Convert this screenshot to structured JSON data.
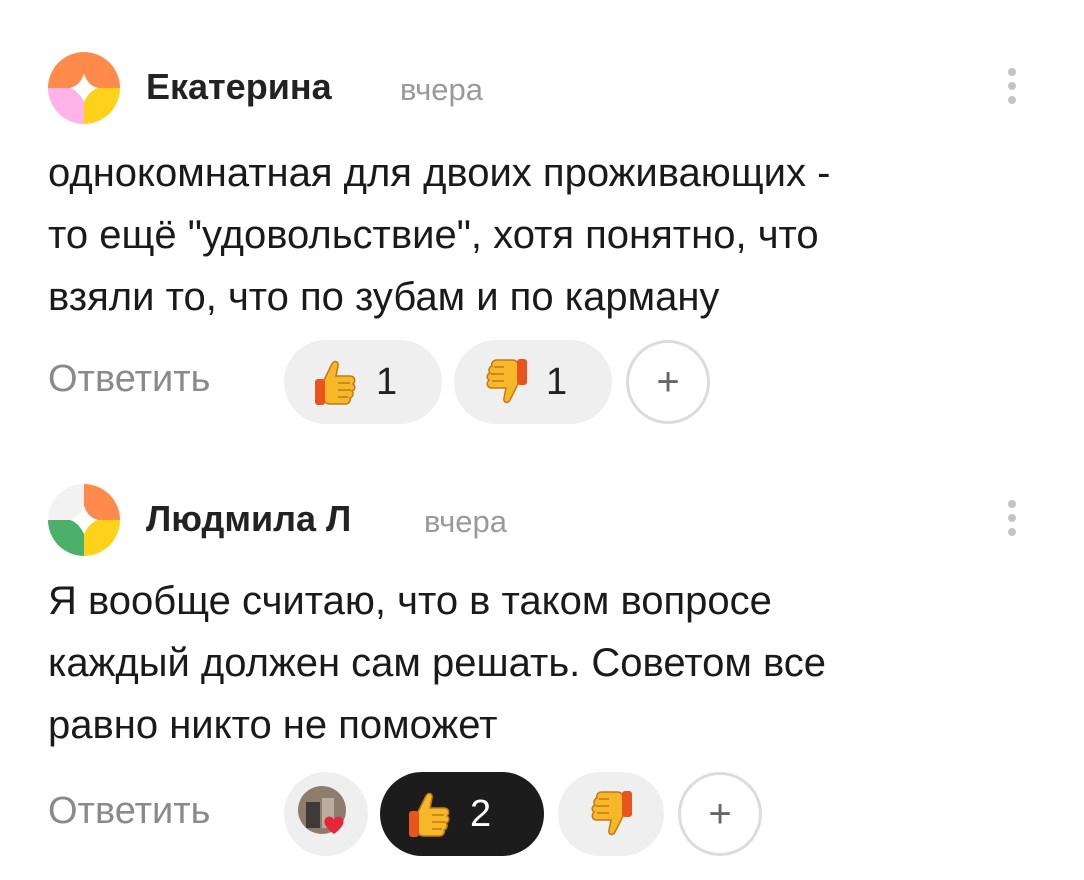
{
  "comments": [
    {
      "author": "Екатерина",
      "time": "вчера",
      "lines": [
        "однокомнатная для двоих проживающих -",
        "то ещё \"удовольствие\", хотя понятно, что",
        "взяли то, что по зубам и по карману"
      ],
      "reply_label": "Ответить",
      "likes": "1",
      "dislikes": "1",
      "liked_by_user": false
    },
    {
      "author": "Людмила Л",
      "time": "вчера",
      "lines": [
        "Я вообще считаю, что в таком вопросе",
        "каждый должен сам решать. Советом все",
        "равно никто не поможет"
      ],
      "reply_label": "Ответить",
      "likes": "2",
      "liked_by_user": true
    }
  ],
  "icons": {
    "like": "thumbs-up-emoji",
    "dislike": "thumbs-down-emoji",
    "add": "+",
    "more": "more-vertical-icon",
    "reaction_avatar": "heart-reaction-avatar"
  },
  "colors": {
    "pill_bg": "#efefef",
    "pill_active_bg": "#1c1c1c",
    "muted_text": "#8a8a8a",
    "heart": "#e8233a"
  }
}
